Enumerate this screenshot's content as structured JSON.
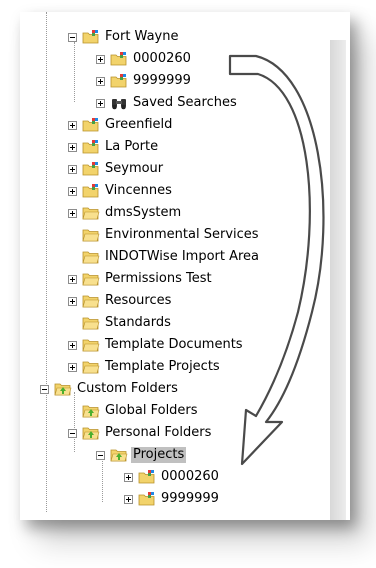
{
  "tree": {
    "items": [
      {
        "label": "Fort Wayne",
        "icon": "project-folder-icon"
      },
      {
        "label": "0000260",
        "icon": "project-folder-icon"
      },
      {
        "label": "9999999",
        "icon": "project-folder-icon"
      },
      {
        "label": "Saved Searches",
        "icon": "binoculars-icon"
      },
      {
        "label": "Greenfield",
        "icon": "project-folder-icon"
      },
      {
        "label": "La Porte",
        "icon": "project-folder-icon"
      },
      {
        "label": "Seymour",
        "icon": "project-folder-icon"
      },
      {
        "label": "Vincennes",
        "icon": "project-folder-icon"
      },
      {
        "label": "dmsSystem",
        "icon": "folder-icon"
      },
      {
        "label": "Environmental Services",
        "icon": "folder-icon"
      },
      {
        "label": "INDOTWise Import Area",
        "icon": "folder-icon"
      },
      {
        "label": "Permissions Test",
        "icon": "folder-icon"
      },
      {
        "label": "Resources",
        "icon": "folder-icon"
      },
      {
        "label": "Standards",
        "icon": "folder-icon"
      },
      {
        "label": "Template Documents",
        "icon": "folder-icon"
      },
      {
        "label": "Template Projects",
        "icon": "folder-icon"
      },
      {
        "label": "Custom Folders",
        "icon": "custom-folder-icon"
      },
      {
        "label": "Global Folders",
        "icon": "custom-folder-icon"
      },
      {
        "label": "Personal Folders",
        "icon": "custom-folder-icon"
      },
      {
        "label": "Projects",
        "icon": "custom-folder-icon"
      },
      {
        "label": "0000260",
        "icon": "project-folder-icon"
      },
      {
        "label": "9999999",
        "icon": "project-folder-icon"
      }
    ],
    "selected_label": "Projects"
  },
  "colors": {
    "folder": "#f2d36b",
    "folder_dark": "#c9a227",
    "selection": "#c0c0c0",
    "custom_green": "#4caf2e"
  }
}
